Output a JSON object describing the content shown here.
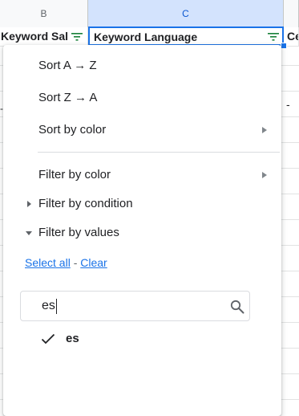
{
  "columns": {
    "b_letter": "B",
    "c_letter": "C"
  },
  "header_cells": {
    "b": "Keyword Sal",
    "c": "Keyword Language",
    "d": "Ce"
  },
  "cells": {
    "dash_left": "-",
    "dash_right": "-"
  },
  "menu": {
    "sort_az": "Sort A → Z",
    "sort_za": "Sort Z → A",
    "sort_by_color": "Sort by color",
    "filter_by_color": "Filter by color",
    "filter_by_condition": "Filter by condition",
    "filter_by_values": "Filter by values",
    "select_all": "Select all",
    "separator": "-",
    "clear": "Clear",
    "search_value": "es",
    "values": [
      {
        "label": "es",
        "checked": true
      }
    ]
  },
  "colors": {
    "accent": "#1a73e8",
    "filter_icon": "#188038",
    "selected_col": "#d3e3fd"
  }
}
